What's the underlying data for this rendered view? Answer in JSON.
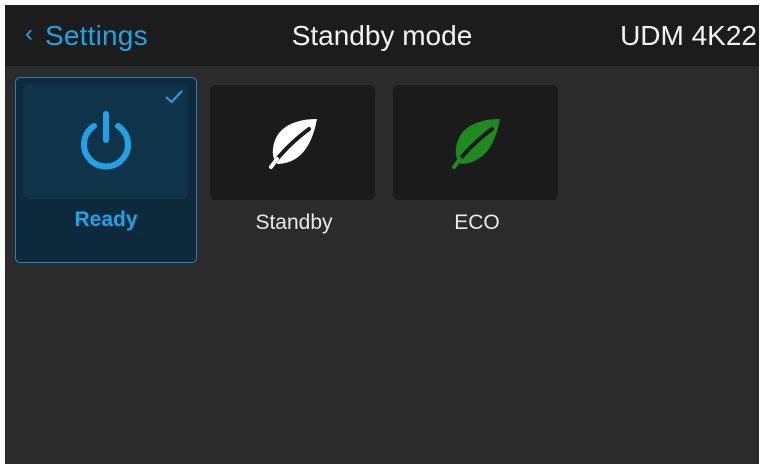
{
  "header": {
    "back_chevron": "‹",
    "back_label": "Settings",
    "title": "Standby mode",
    "device": "UDM 4K22"
  },
  "modes": [
    {
      "label": "Ready",
      "icon": "power-icon",
      "selected": true
    },
    {
      "label": "Standby",
      "icon": "leaf-icon",
      "selected": false
    },
    {
      "label": "ECO",
      "icon": "leaf-icon",
      "selected": false
    }
  ],
  "colors": {
    "accent": "#1ea3e8",
    "eco_leaf": "#1f8a1f",
    "standby_leaf": "#ffffff",
    "background": "#2b2b2b",
    "header": "#1c1c1c"
  }
}
